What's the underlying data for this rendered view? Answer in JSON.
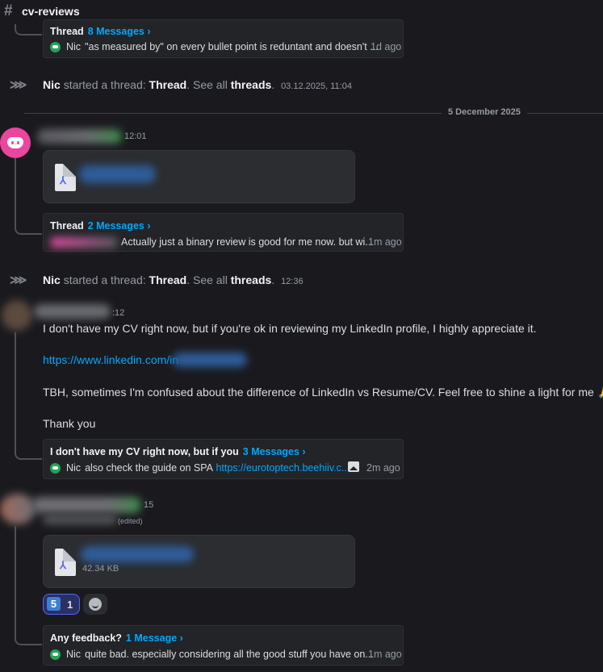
{
  "channel": {
    "hash": "#",
    "name": "cv-reviews"
  },
  "threads": {
    "t1": {
      "title": "Thread",
      "count": "8 Messages ›",
      "author": "Nic",
      "preview": "\"as measured by\" on every bullet point is reduntant and doesn't ...",
      "time": "1d ago"
    },
    "t2": {
      "title": "Thread",
      "count": "2 Messages ›",
      "preview": "Actually just a binary review is good for me now. but wi...",
      "time": "1m ago"
    },
    "t3": {
      "title": "I don't have my CV right now, but if you",
      "count": "3 Messages ›",
      "author": "Nic",
      "preview_text": "also check the guide on SPA",
      "preview_link": "https://eurotoptech.beehiiv.c...",
      "time": "2m ago"
    },
    "t4": {
      "title": "Any feedback?",
      "count": "1 Message ›",
      "author": "Nic",
      "preview": "quite bad. especially considering all the good stuff you have on...",
      "time": "1m ago"
    }
  },
  "system": {
    "s1": {
      "actor": "Nic",
      "verb": "started a thread:",
      "thread": "Thread",
      "see_all": "See all",
      "threads": "threads",
      "period": ".",
      "timestamp": "03.12.2025, 11:04"
    },
    "s2": {
      "actor": "Nic",
      "verb": "started a thread:",
      "thread": "Thread",
      "see_all": "See all",
      "threads": "threads",
      "period": ".",
      "timestamp": "12:36"
    }
  },
  "divider": {
    "date": "5 December 2025"
  },
  "messages": {
    "m1": {
      "time": "12:01"
    },
    "m2": {
      "time_fragment": ":12",
      "line1": "I don't have my CV right now, but if you're ok in reviewing my LinkedIn profile, I highly appreciate it.",
      "link": "https://www.linkedin.com/in",
      "line3": "TBH, sometimes I'm confused about the difference of LinkedIn vs Resume/CV. Feel free to shine a light for me",
      "line3_emoji": "🙏",
      "line4": "Thank you"
    },
    "m3": {
      "time_fragment": "15",
      "edited": "(edited)",
      "file_size": "42.34 KB",
      "reaction_emoji": "5",
      "reaction_count": "1"
    }
  },
  "colors": {
    "background": "#1a1a1e",
    "link": "#00a8fc",
    "discord_avatar": "#eb459f",
    "online": "#23a55a"
  }
}
